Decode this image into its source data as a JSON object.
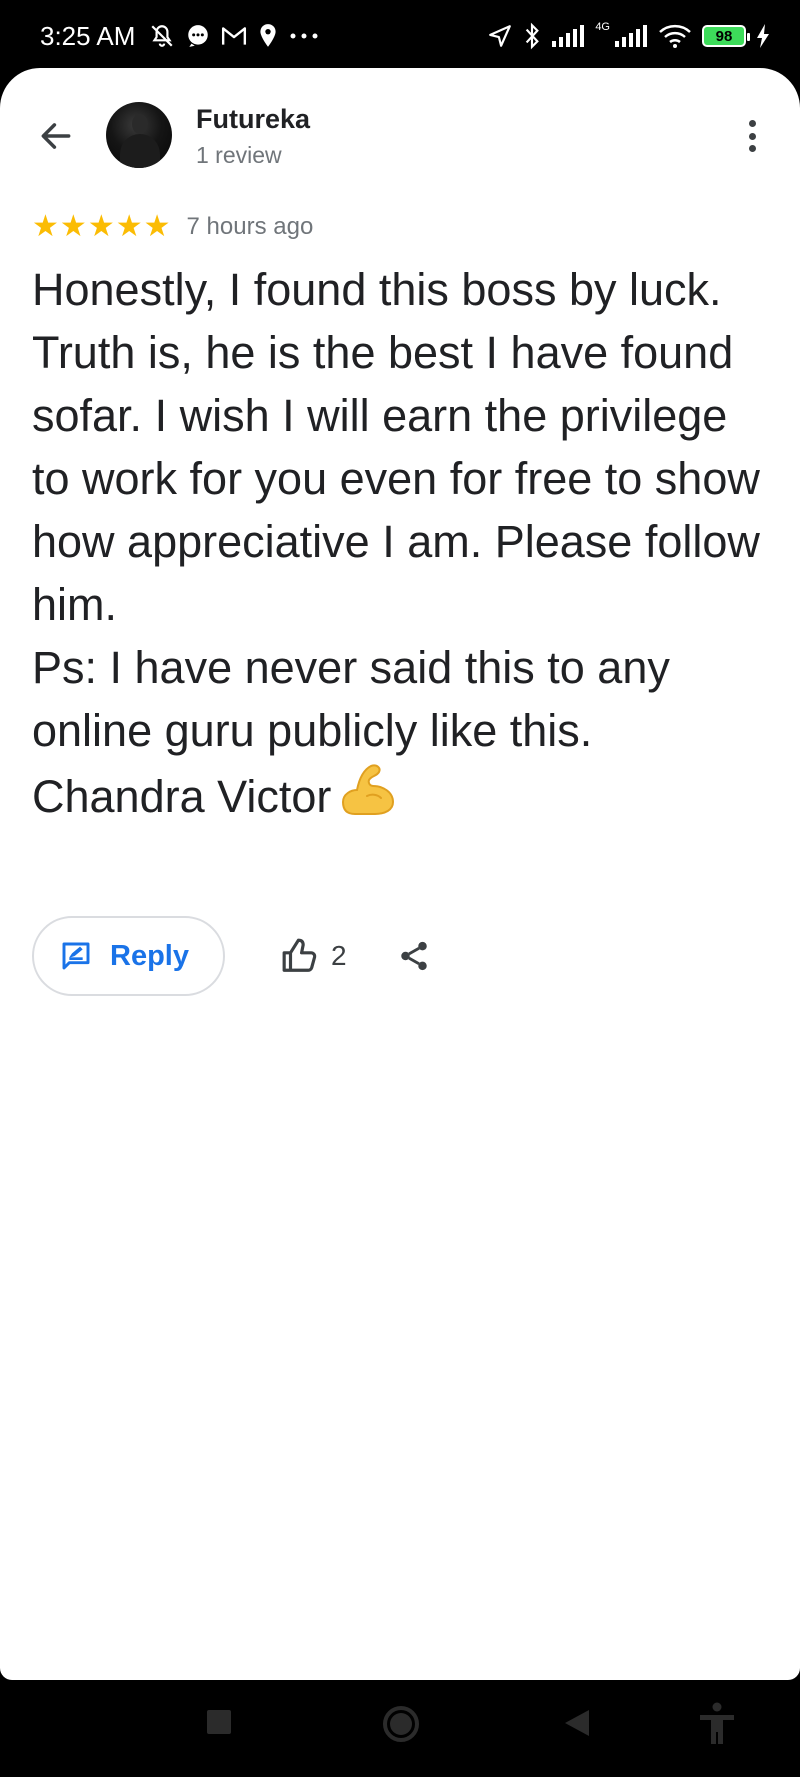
{
  "status_bar": {
    "time": "3:25 AM",
    "network_label": "4G",
    "battery": "98",
    "icons": [
      "bell-off-icon",
      "chat-bubble-icon",
      "gmail-icon",
      "location-pin-icon",
      "more-dots-icon",
      "navigation-arrow-icon",
      "bluetooth-icon",
      "signal-icon",
      "signal-4g-icon",
      "wifi-icon",
      "battery-icon",
      "charging-bolt-icon"
    ]
  },
  "header": {
    "name": "Futureka",
    "subtitle": "1 review"
  },
  "review": {
    "rating": 5,
    "max_rating": 5,
    "time_ago": "7 hours ago",
    "paragraphs": [
      "Honestly, I found this boss by luck.",
      "Truth is, he is the best I have found sofar. I wish I will earn the privilege to work for you even for free to show how appreciative I am. Please follow him.",
      "Ps: I have never said this to any online guru publicly like this."
    ],
    "signature": "Chandra Victor",
    "emoji": "💪"
  },
  "actions": {
    "reply_label": "Reply",
    "like_count": "2"
  },
  "colors": {
    "accent": "#1a73e8",
    "star": "#fbbc04",
    "text": "#202124",
    "muted": "#70757a",
    "battery": "#3ddc5a"
  }
}
